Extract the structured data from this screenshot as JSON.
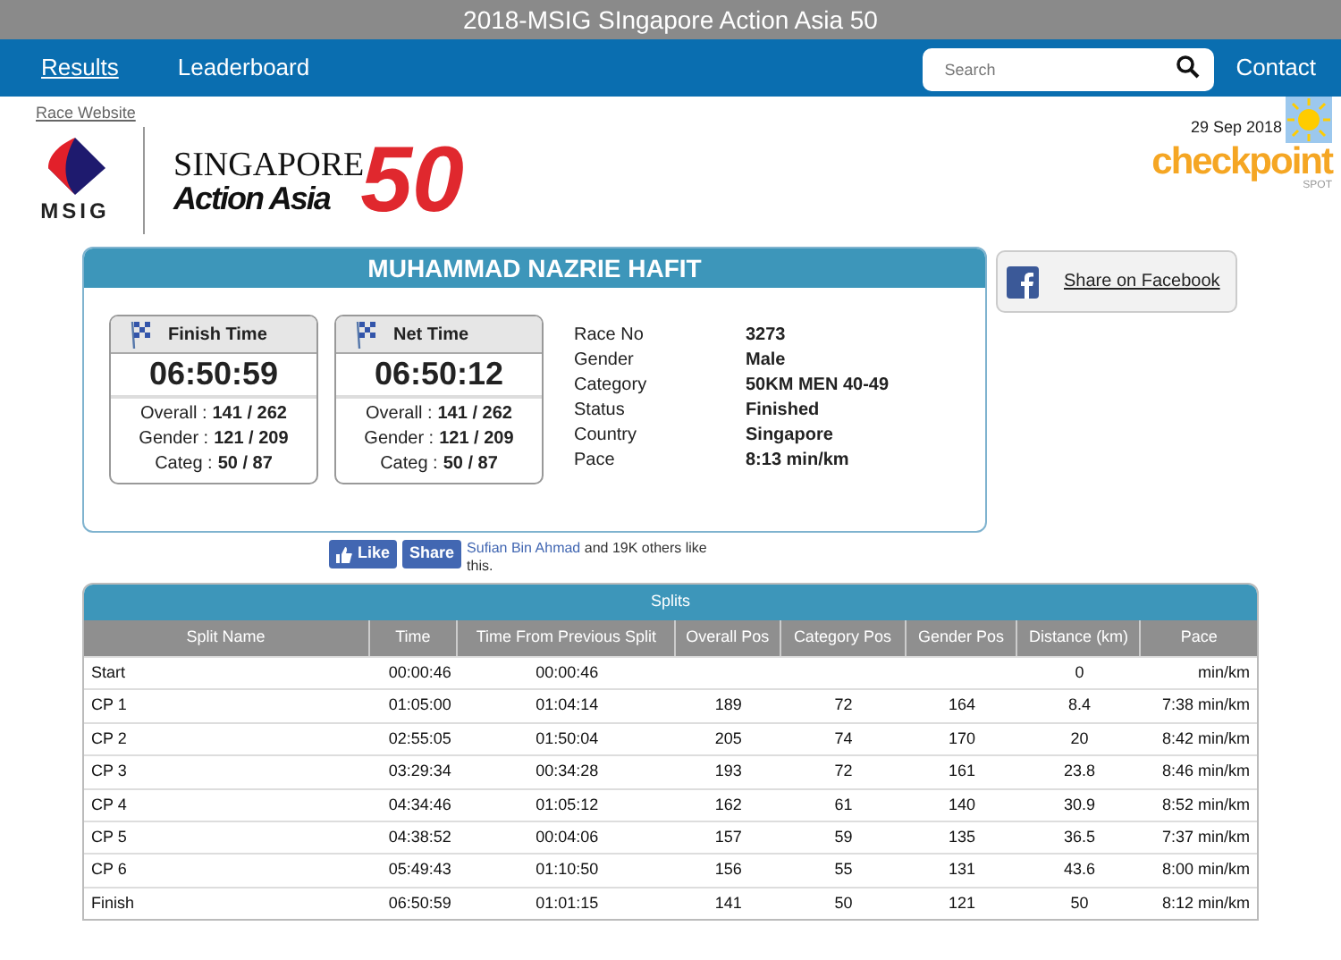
{
  "window": {
    "title": "2018-MSIG SIngapore Action Asia 50"
  },
  "nav": {
    "items": [
      {
        "label": "Results",
        "selected": true
      },
      {
        "label": "Leaderboard",
        "selected": false
      }
    ],
    "search": {
      "placeholder": "Search"
    },
    "contact": "Contact"
  },
  "header": {
    "race_website": "Race Website",
    "sponsor_logo": "MSIG",
    "race_logo": {
      "line_1": "SINGAPORE",
      "line_2": "Action Asia",
      "number": "50"
    },
    "date": "29 Sep 2018",
    "brand": {
      "main": "checkpoint",
      "sub": "SPOT"
    }
  },
  "athlete": {
    "name": "MUHAMMAD NAZRIE HAFIT",
    "time_cards": [
      {
        "title": "Finish Time",
        "time": "06:50:59",
        "ranks": [
          {
            "label": "Overall :",
            "value": "141 / 262"
          },
          {
            "label": "Gender :",
            "value": "121 / 209"
          },
          {
            "label": "Categ :",
            "value": "50 / 87"
          }
        ]
      },
      {
        "title": "Net Time",
        "time": "06:50:12",
        "ranks": [
          {
            "label": "Overall :",
            "value": "141 / 262"
          },
          {
            "label": "Gender :",
            "value": "121 / 209"
          },
          {
            "label": "Categ :",
            "value": "50 / 87"
          }
        ]
      }
    ],
    "details": [
      {
        "label": "Race No",
        "value": "3273"
      },
      {
        "label": "Gender",
        "value": "Male"
      },
      {
        "label": "Category",
        "value": "50KM MEN 40-49"
      },
      {
        "label": "Status",
        "value": "Finished"
      },
      {
        "label": "Country",
        "value": "Singapore"
      },
      {
        "label": "Pace",
        "value": "8:13 min/km"
      }
    ]
  },
  "share_button": "Share on Facebook",
  "social": {
    "like": "Like",
    "share": "Share",
    "friend": "Sufian Bin Ahmad",
    "text": "and 19K others like this."
  },
  "splits": {
    "title": "Splits",
    "columns": [
      "Split Name",
      "Time",
      "Time From Previous Split",
      "Overall Pos",
      "Category Pos",
      "Gender Pos",
      "Distance (km)",
      "Pace"
    ],
    "rows": [
      [
        "Start",
        "00:00:46",
        "00:00:46",
        "",
        "",
        "",
        "0",
        "min/km"
      ],
      [
        "CP 1",
        "01:05:00",
        "01:04:14",
        "189",
        "72",
        "164",
        "8.4",
        "7:38 min/km"
      ],
      [
        "CP 2",
        "02:55:05",
        "01:50:04",
        "205",
        "74",
        "170",
        "20",
        "8:42 min/km"
      ],
      [
        "CP 3",
        "03:29:34",
        "00:34:28",
        "193",
        "72",
        "161",
        "23.8",
        "8:46 min/km"
      ],
      [
        "CP 4",
        "04:34:46",
        "01:05:12",
        "162",
        "61",
        "140",
        "30.9",
        "8:52 min/km"
      ],
      [
        "CP 5",
        "04:38:52",
        "00:04:06",
        "157",
        "59",
        "135",
        "36.5",
        "7:37 min/km"
      ],
      [
        "CP 6",
        "05:49:43",
        "01:10:50",
        "156",
        "55",
        "131",
        "43.6",
        "8:00 min/km"
      ],
      [
        "Finish",
        "06:50:59",
        "01:01:15",
        "141",
        "50",
        "121",
        "50",
        "8:12 min/km"
      ]
    ]
  }
}
